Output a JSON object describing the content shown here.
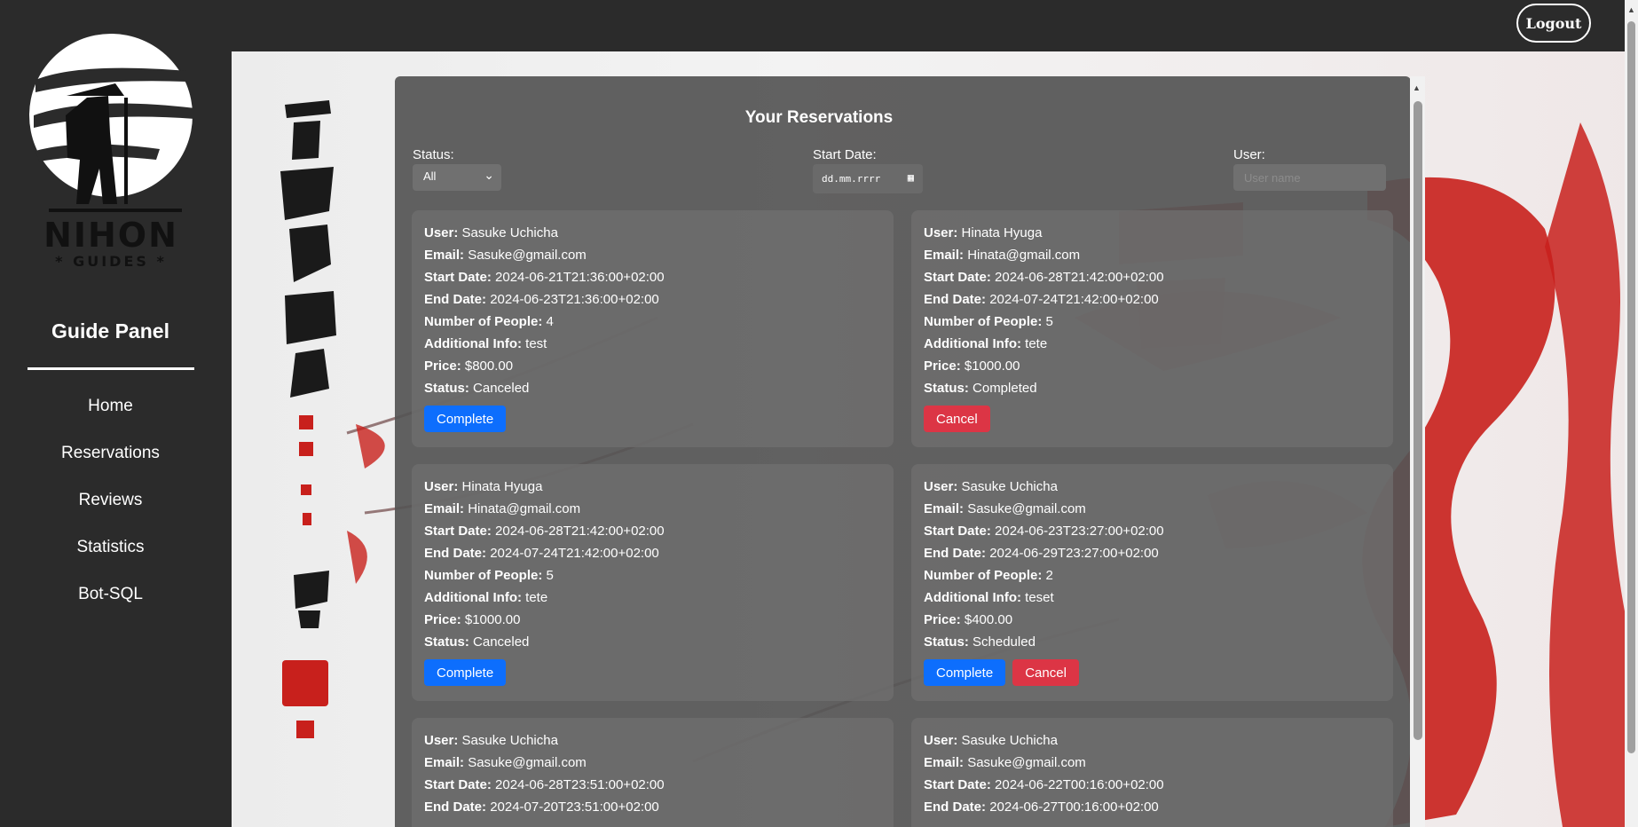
{
  "header": {
    "logout_label": "Logout"
  },
  "sidebar": {
    "logo_text": "NIHON",
    "logo_subtext": "* GUIDES *",
    "panel_title": "Guide Panel",
    "nav": [
      {
        "label": "Home"
      },
      {
        "label": "Reservations"
      },
      {
        "label": "Reviews"
      },
      {
        "label": "Statistics"
      },
      {
        "label": "Bot-SQL"
      }
    ]
  },
  "main": {
    "heading": "Your Reservations",
    "filters": {
      "status_label": "Status:",
      "status_value": "All",
      "start_date_label": "Start Date:",
      "start_date_placeholder": "dd.mm.rrrr",
      "user_label": "User:",
      "user_placeholder": "User name"
    },
    "field_labels": {
      "user": "User:",
      "email": "Email:",
      "start": "Start Date:",
      "end": "End Date:",
      "people": "Number of People:",
      "info": "Additional Info:",
      "price": "Price:",
      "status": "Status:"
    },
    "buttons": {
      "complete": "Complete",
      "cancel": "Cancel"
    },
    "reservations": [
      {
        "user": "Sasuke Uchicha",
        "email": "Sasuke@gmail.com",
        "start": "2024-06-21T21:36:00+02:00",
        "end": "2024-06-23T21:36:00+02:00",
        "people": "4",
        "info": "test",
        "price": "$800.00",
        "status": "Canceled"
      },
      {
        "user": "Hinata Hyuga",
        "email": "Hinata@gmail.com",
        "start": "2024-06-28T21:42:00+02:00",
        "end": "2024-07-24T21:42:00+02:00",
        "people": "5",
        "info": "tete",
        "price": "$1000.00",
        "status": "Completed"
      },
      {
        "user": "Hinata Hyuga",
        "email": "Hinata@gmail.com",
        "start": "2024-06-28T21:42:00+02:00",
        "end": "2024-07-24T21:42:00+02:00",
        "people": "5",
        "info": "tete",
        "price": "$1000.00",
        "status": "Canceled"
      },
      {
        "user": "Sasuke Uchicha",
        "email": "Sasuke@gmail.com",
        "start": "2024-06-23T23:27:00+02:00",
        "end": "2024-06-29T23:27:00+02:00",
        "people": "2",
        "info": "teset",
        "price": "$400.00",
        "status": "Scheduled"
      },
      {
        "user": "Sasuke Uchicha",
        "email": "Sasuke@gmail.com",
        "start": "2024-06-28T23:51:00+02:00",
        "end": "2024-07-20T23:51:00+02:00"
      },
      {
        "user": "Sasuke Uchicha",
        "email": "Sasuke@gmail.com",
        "start": "2024-06-22T00:16:00+02:00",
        "end": "2024-06-27T00:16:00+02:00"
      }
    ]
  },
  "colors": {
    "sidebar": "#2b2b2b",
    "panel": "#555555",
    "complete_button": "#0d6efd",
    "cancel_button": "#dc3545",
    "art_red": "#c8201c"
  }
}
